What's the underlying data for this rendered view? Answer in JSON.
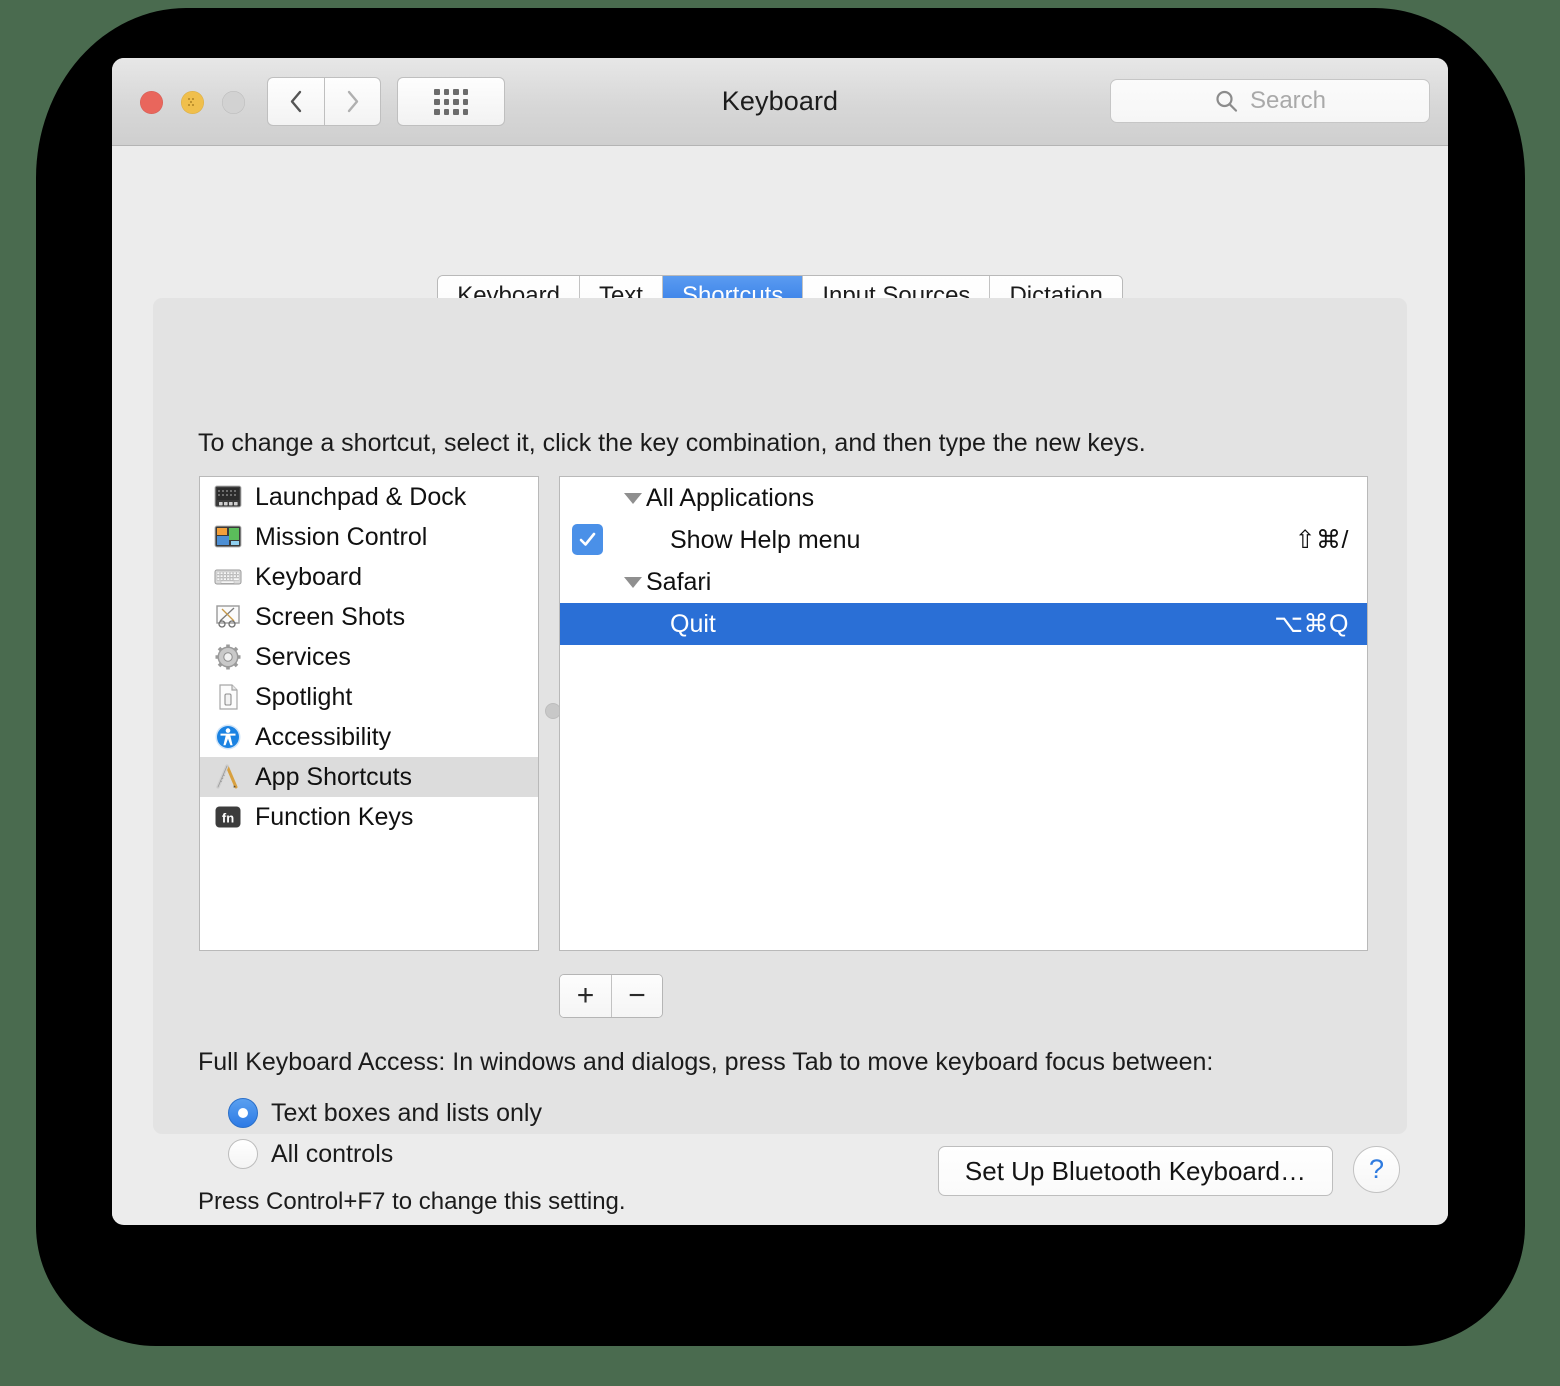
{
  "window": {
    "title": "Keyboard",
    "traffic_lights": [
      "close-button",
      "minimize-button",
      "zoom-button"
    ],
    "nav": {
      "back": "back-icon",
      "forward": "forward-icon",
      "show_all": "grid-icon"
    },
    "search": {
      "placeholder": "Search",
      "icon": "search-icon"
    }
  },
  "tabs": [
    {
      "label": "Keyboard",
      "active": false
    },
    {
      "label": "Text",
      "active": false
    },
    {
      "label": "Shortcuts",
      "active": true
    },
    {
      "label": "Input Sources",
      "active": false
    },
    {
      "label": "Dictation",
      "active": false
    }
  ],
  "instruction": "To change a shortcut, select it, click the key combination, and then type the new keys.",
  "sidebar": {
    "items": [
      {
        "label": "Launchpad & Dock",
        "icon": "launchpad-dock-icon",
        "selected": false
      },
      {
        "label": "Mission Control",
        "icon": "mission-control-icon",
        "selected": false
      },
      {
        "label": "Keyboard",
        "icon": "keyboard-icon",
        "selected": false
      },
      {
        "label": "Screen Shots",
        "icon": "screen-shots-icon",
        "selected": false
      },
      {
        "label": "Services",
        "icon": "services-gear-icon",
        "selected": false
      },
      {
        "label": "Spotlight",
        "icon": "spotlight-document-icon",
        "selected": false
      },
      {
        "label": "Accessibility",
        "icon": "accessibility-icon",
        "selected": false
      },
      {
        "label": "App Shortcuts",
        "icon": "app-shortcuts-icon",
        "selected": true
      },
      {
        "label": "Function Keys",
        "icon": "fn-key-icon",
        "selected": false
      }
    ]
  },
  "shortcuts": {
    "rows": [
      {
        "type": "group",
        "label": "All Applications",
        "keys": "",
        "checked": null,
        "selected": false
      },
      {
        "type": "item",
        "label": "Show Help menu",
        "keys": "⇧⌘/",
        "checked": true,
        "selected": false
      },
      {
        "type": "group",
        "label": "Safari",
        "keys": "",
        "checked": null,
        "selected": false
      },
      {
        "type": "item",
        "label": "Quit",
        "keys": "⌥⌘Q",
        "checked": false,
        "selected": true
      }
    ]
  },
  "list_buttons": {
    "add": "+",
    "remove": "−"
  },
  "full_keyboard_access": {
    "title": "Full Keyboard Access: In windows and dialogs, press Tab to move keyboard focus between:",
    "options": [
      {
        "label": "Text boxes and lists only",
        "selected": true
      },
      {
        "label": "All controls",
        "selected": false
      }
    ],
    "note": "Press Control+F7 to change this setting."
  },
  "footer": {
    "bluetooth_button": "Set Up Bluetooth Keyboard…",
    "help_button": "?"
  },
  "colors": {
    "accent_blue": "#2a6fd6",
    "tab_active": "#2f78e4",
    "window_bg": "#ececec",
    "panel_bg": "#e3e3e3"
  }
}
